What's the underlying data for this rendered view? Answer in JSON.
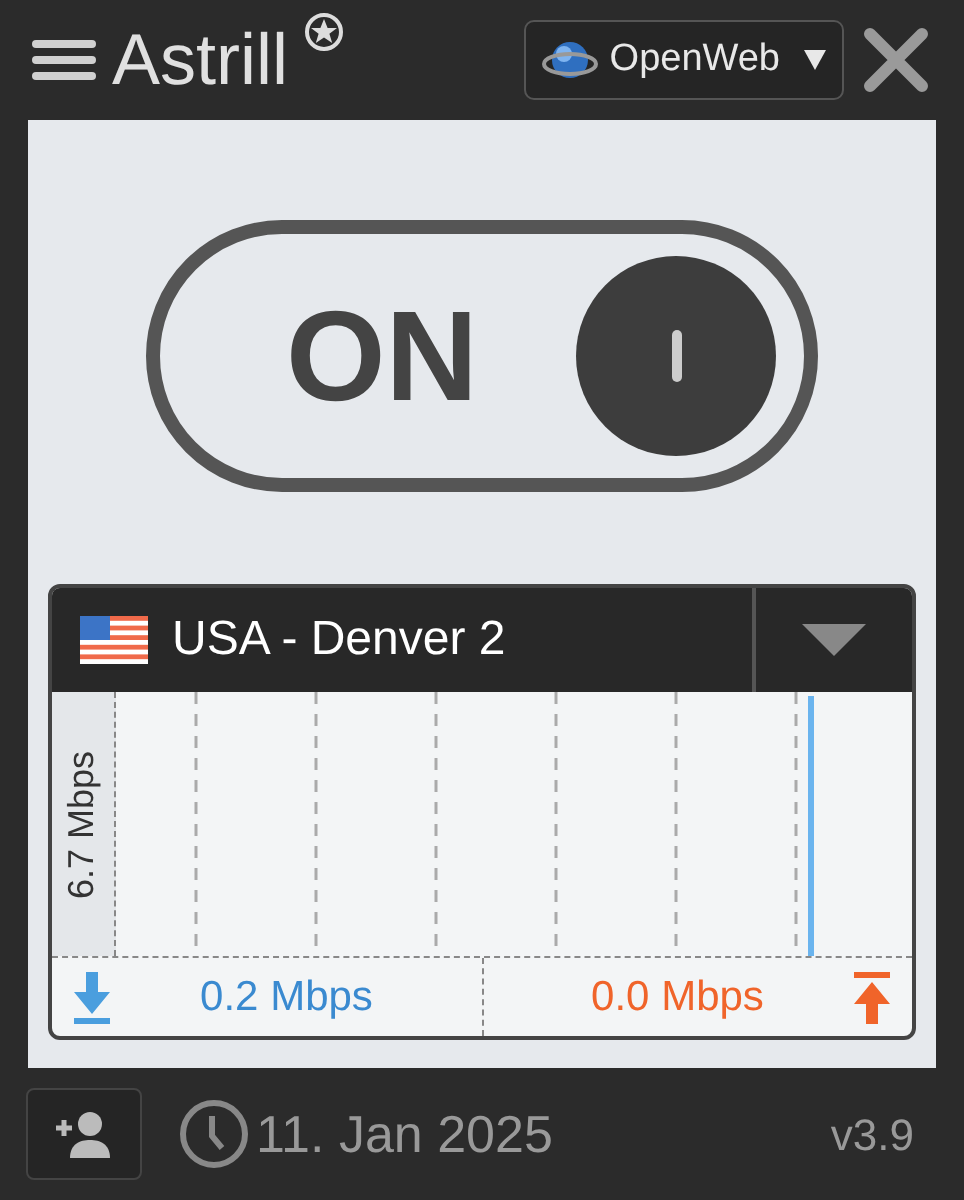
{
  "header": {
    "brand": "Astrill",
    "mode": "OpenWeb"
  },
  "power": {
    "label": "ON",
    "on": true
  },
  "server": {
    "name": "USA - Denver 2"
  },
  "graph": {
    "scale": "6.7 Mbps",
    "download": "0.2 Mbps",
    "upload": "0.0 Mbps"
  },
  "footer": {
    "date": "11. Jan 2025",
    "version": "v3.9"
  }
}
